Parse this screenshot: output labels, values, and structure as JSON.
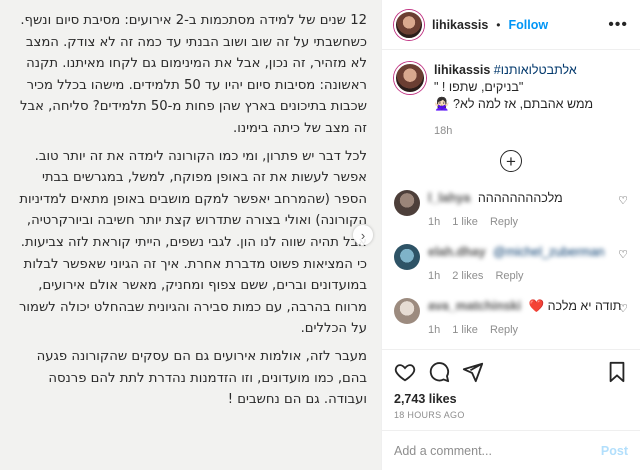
{
  "post_image": {
    "paragraphs": [
      "12 שנים של למידה מסתכמות ב-2 אירועים: מסיבת סיום ונשף. כשחשבתי על זה שוב ושוב הבנתי עד כמה זה לא צודק. המצב לא מזהיר, זה נכון, אבל את המינימום גם לקחו מאיתנו. תקנה ראשונה: מסיבות סיום יהיו עד 50 תלמידים. מישהו בכלל מכיר שכבות בתיכונים בארץ שהן פחות מ-50 תלמידים? סליחה, אבל זה מצב של כיתה בימינו.",
      "לכל דבר יש פתרון, ומי כמו הקורונה לימדה את זה יותר טוב. אפשר לעשות את זה באופן מפוקח, למשל, במגרשים בבתי הספר (שהמרחב יאפשר למקם מושבים באופן מתאים למדיניות הקורונה) ואולי בצורה שתדרוש קצת יותר חשיבה וביורקרטיה, אבל תהיה שווה לנו הון. לגבי נשפים, הייתי קוראת לזה צביעות. כי המציאות פשוט מדברת אחרת. איך זה הגיוני שאפשר לבלות במועדונים וברים, ששם צפוף ומחניק, מאשר אולם אירועים, מרווח בהרבה, עם כמות סבירה והגיונית שבהחלט יכולה לשמור על הכללים.",
      "מעבר לזה, אולמות אירועים גם הם עסקים שהקורונה פגעה בהם, כמו מועדונים, וזו הזדמנות נהדרת לתת להם פרנסה ועבודה. גם הם נחשבים !"
    ],
    "next_arrow": "›"
  },
  "header": {
    "username": "lihikassis",
    "separator": "•",
    "follow_label": "Follow",
    "more_label": "•••"
  },
  "caption": {
    "username": "lihikassis",
    "hashtag": "#אלתבטלואותנו",
    "line2": "\"בניקים, שתפו ! \"",
    "line3": "ממש אהבתם, אז למה לא? 🙅🏻‍♀️",
    "time": "18h"
  },
  "load_more_icon": "+",
  "comments": [
    {
      "username": "l_lahya",
      "text": "מלכהההההההה",
      "time": "1h",
      "likes": "1 like",
      "reply": "Reply",
      "avatar_color": "#6b5a52"
    },
    {
      "username": "elah.dhay",
      "mention": "@michel_zuberman",
      "text": "",
      "time": "1h",
      "likes": "2 likes",
      "reply": "Reply",
      "avatar_color": "#3d6e86"
    },
    {
      "username": "ava_matchinski",
      "text": "תודה יא מלכה ❤️",
      "time": "1h",
      "likes": "1 like",
      "reply": "Reply",
      "avatar_color": "#c8b7a9"
    }
  ],
  "stats": {
    "likes": "2,743 likes",
    "date": "18 HOURS AGO"
  },
  "add_comment": {
    "placeholder": "Add a comment...",
    "post_label": "Post"
  },
  "colors": {
    "accent": "#0095f6",
    "hashtag": "#00376b",
    "muted": "#8e8e8e"
  }
}
